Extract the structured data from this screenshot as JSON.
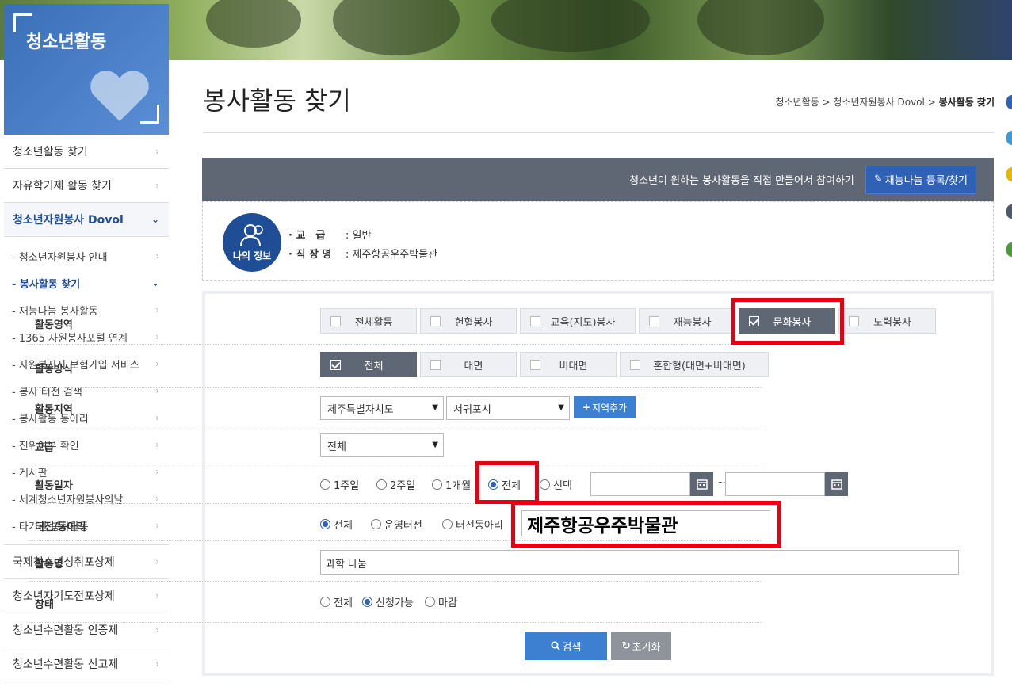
{
  "lnb": {
    "title": "청소년활동",
    "items": [
      {
        "label": "청소년활동 찾기"
      },
      {
        "label": "자유학기제 활동 찾기"
      },
      {
        "label": "청소년자원봉사 Dovol"
      }
    ],
    "sub_items": [
      {
        "label": "- 청소년자원봉사 안내"
      },
      {
        "label": "- 봉사활동 찾기"
      },
      {
        "label": "- 재능나눔 봉사활동"
      },
      {
        "label": "- 1365 자원봉사포털 연계"
      },
      {
        "label": "- 자원봉사자 보험가입 서비스"
      },
      {
        "label": "- 봉사 터전 검색"
      },
      {
        "label": "- 봉사활동 동아리"
      },
      {
        "label": "- 진위여부 확인"
      },
      {
        "label": "- 게시판"
      },
      {
        "label": "- 세계청소년자원봉사의날"
      },
      {
        "label": "- 타기관 봉사활동"
      }
    ],
    "bottom_items": [
      {
        "label": "국제청소년성취포상제"
      },
      {
        "label": "청소년자기도전포상제"
      },
      {
        "label": "청소년수련활동 인증제"
      },
      {
        "label": "청소년수련활동 신고제"
      }
    ]
  },
  "header": {
    "title": "봉사활동 찾기",
    "breadcrumb_1": "청소년활동",
    "breadcrumb_2": "청소년자원봉사 Dovol",
    "breadcrumb_3": "봉사활동 찾기",
    "sep": ">"
  },
  "banner_bar": {
    "text": "청소년이 원하는 봉사활동을 직접 만들어서 참여하기",
    "button": "재능나눔 등록/찾기"
  },
  "my_info": {
    "avatar_label": "나의 정보",
    "rows": [
      {
        "key": "· 교　급",
        "value": ": 일반"
      },
      {
        "key": "· 직 장 명",
        "value": ": 제주항공우주박물관"
      }
    ]
  },
  "form": {
    "area": {
      "label": "활동영역",
      "options": [
        {
          "label": "전체활동",
          "checked": false
        },
        {
          "label": "헌혈봉사",
          "checked": false
        },
        {
          "label": "교육(지도)봉사",
          "checked": false
        },
        {
          "label": "재능봉사",
          "checked": false
        },
        {
          "label": "문화봉사",
          "checked": true
        },
        {
          "label": "노력봉사",
          "checked": false
        }
      ]
    },
    "method": {
      "label": "활동방식",
      "options": [
        {
          "label": "전체",
          "checked": true
        },
        {
          "label": "대면",
          "checked": false
        },
        {
          "label": "비대면",
          "checked": false
        },
        {
          "label": "혼합형(대면+비대면)",
          "checked": false
        }
      ]
    },
    "region": {
      "label": "활동지역",
      "province": "제주특별자치도",
      "city": "서귀포시",
      "add_button": "지역추가"
    },
    "grade": {
      "label": "교급",
      "value": "전체"
    },
    "date": {
      "label": "활동일자",
      "options": [
        "1주일",
        "2주일",
        "1개월",
        "전체",
        "선택"
      ],
      "selected": "전체",
      "tilde": "~"
    },
    "venue": {
      "label": "터전/동아리",
      "options": [
        "전체",
        "운영터전",
        "터전동아리"
      ],
      "selected": "전체",
      "input_value": "제주항공우주박물관"
    },
    "name": {
      "label": "활동명",
      "value": "과학 나눔"
    },
    "status": {
      "label": "상태",
      "options": [
        "전체",
        "신청가능",
        "마감"
      ],
      "selected": "신청가능"
    },
    "search_button": "검색",
    "reset_button": "초기화"
  },
  "colors": {
    "primary": "#2f62b5",
    "dark_bar": "#5f6674",
    "highlight": "#e60012"
  }
}
